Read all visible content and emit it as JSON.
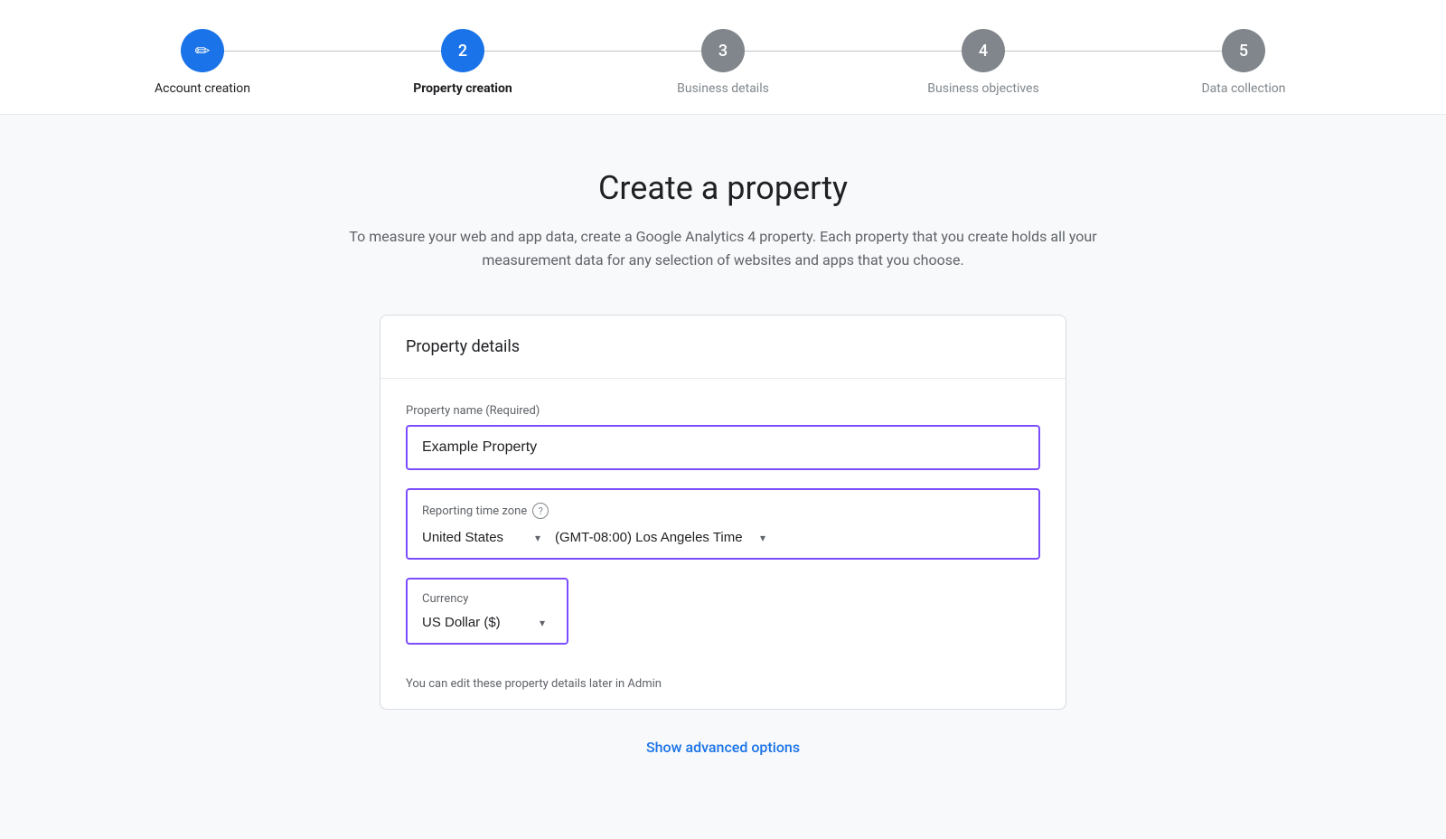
{
  "stepper": {
    "steps": [
      {
        "id": "account-creation",
        "number": "✏",
        "label": "Account creation",
        "state": "completed"
      },
      {
        "id": "property-creation",
        "number": "2",
        "label": "Property creation",
        "state": "active"
      },
      {
        "id": "business-details",
        "number": "3",
        "label": "Business details",
        "state": "inactive"
      },
      {
        "id": "business-objectives",
        "number": "4",
        "label": "Business objectives",
        "state": "inactive"
      },
      {
        "id": "data-collection",
        "number": "5",
        "label": "Data collection",
        "state": "inactive"
      }
    ]
  },
  "page": {
    "title": "Create a property",
    "description": "To measure your web and app data, create a Google Analytics 4 property. Each property that you create holds all your measurement data for any selection of websites and apps that you choose."
  },
  "card": {
    "header": "Property details",
    "property_name_label": "Property name (Required)",
    "property_name_value": "Example Property",
    "reporting_timezone_label": "Reporting time zone",
    "country_value": "United States",
    "timezone_value": "(GMT-08:00) Los Angeles Time",
    "currency_label": "Currency",
    "currency_value": "US Dollar ($)",
    "edit_hint": "You can edit these property details later in Admin"
  },
  "advanced_options_label": "Show advanced options"
}
